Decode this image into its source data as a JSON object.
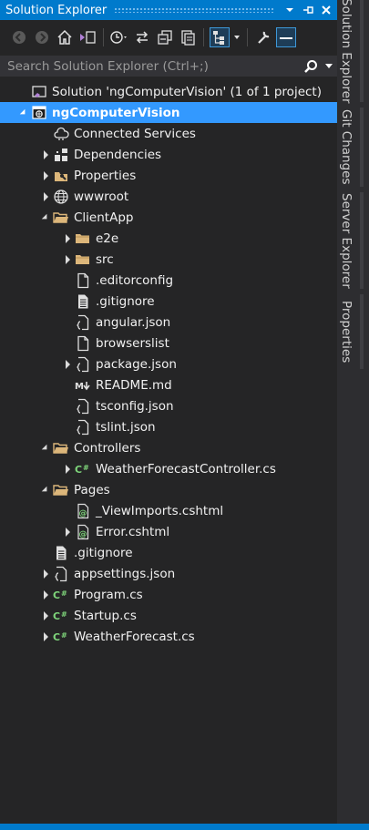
{
  "title": "Solution Explorer",
  "search_placeholder": "Search Solution Explorer (Ctrl+;)",
  "colors": {
    "accent": "#007acc",
    "selection": "#3399ff",
    "background": "#252526"
  },
  "tree": [
    {
      "label": "Solution 'ngComputerVision' (1 of 1 project)",
      "level": 0,
      "expander": "none",
      "icon": "solution-icon"
    },
    {
      "label": "ngComputerVision",
      "level": 0,
      "expander": "expanded",
      "icon": "web-project-icon",
      "selected": true
    },
    {
      "label": "Connected Services",
      "level": 1,
      "expander": "none",
      "icon": "connected-services-icon"
    },
    {
      "label": "Dependencies",
      "level": 1,
      "expander": "collapsed",
      "icon": "dependencies-icon"
    },
    {
      "label": "Properties",
      "level": 1,
      "expander": "collapsed",
      "icon": "properties-icon"
    },
    {
      "label": "wwwroot",
      "level": 1,
      "expander": "collapsed",
      "icon": "globe-icon"
    },
    {
      "label": "ClientApp",
      "level": 1,
      "expander": "expanded",
      "icon": "folder-open-icon"
    },
    {
      "label": "e2e",
      "level": 2,
      "expander": "collapsed",
      "icon": "folder-icon"
    },
    {
      "label": "src",
      "level": 2,
      "expander": "collapsed",
      "icon": "folder-icon"
    },
    {
      "label": ".editorconfig",
      "level": 2,
      "expander": "none",
      "icon": "file-icon"
    },
    {
      "label": ".gitignore",
      "level": 2,
      "expander": "none",
      "icon": "text-file-icon"
    },
    {
      "label": "angular.json",
      "level": 2,
      "expander": "none",
      "icon": "json-icon"
    },
    {
      "label": "browserslist",
      "level": 2,
      "expander": "none",
      "icon": "file-icon"
    },
    {
      "label": "package.json",
      "level": 2,
      "expander": "collapsed",
      "icon": "json-icon"
    },
    {
      "label": "README.md",
      "level": 2,
      "expander": "none",
      "icon": "markdown-icon"
    },
    {
      "label": "tsconfig.json",
      "level": 2,
      "expander": "none",
      "icon": "json-icon"
    },
    {
      "label": "tslint.json",
      "level": 2,
      "expander": "none",
      "icon": "json-icon"
    },
    {
      "label": "Controllers",
      "level": 1,
      "expander": "expanded",
      "icon": "folder-open-icon"
    },
    {
      "label": "WeatherForecastController.cs",
      "level": 2,
      "expander": "collapsed",
      "icon": "csharp-icon"
    },
    {
      "label": "Pages",
      "level": 1,
      "expander": "expanded",
      "icon": "folder-open-icon"
    },
    {
      "label": "_ViewImports.cshtml",
      "level": 2,
      "expander": "none",
      "icon": "razor-icon"
    },
    {
      "label": "Error.cshtml",
      "level": 2,
      "expander": "collapsed",
      "icon": "razor-icon"
    },
    {
      "label": ".gitignore",
      "level": 1,
      "expander": "none",
      "icon": "text-file-icon"
    },
    {
      "label": "appsettings.json",
      "level": 1,
      "expander": "collapsed",
      "icon": "json-icon"
    },
    {
      "label": "Program.cs",
      "level": 1,
      "expander": "collapsed",
      "icon": "csharp-icon"
    },
    {
      "label": "Startup.cs",
      "level": 1,
      "expander": "collapsed",
      "icon": "csharp-icon"
    },
    {
      "label": "WeatherForecast.cs",
      "level": 1,
      "expander": "collapsed",
      "icon": "csharp-icon"
    }
  ],
  "side_tabs": [
    "Solution Explorer",
    "Git Changes",
    "Server Explorer",
    "Properties"
  ]
}
